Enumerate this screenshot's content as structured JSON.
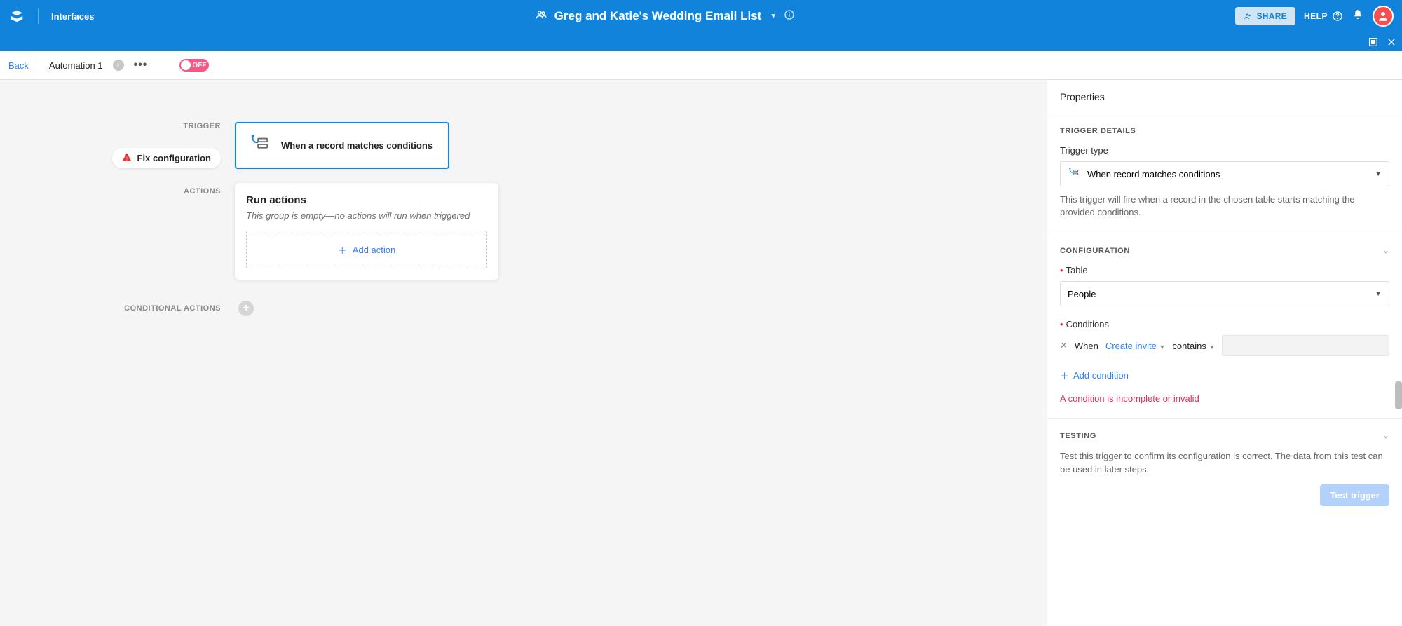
{
  "topbar": {
    "interfaces_label": "Interfaces",
    "base_title": "Greg and Katie's Wedding Email List",
    "share_label": "SHARE",
    "help_label": "HELP"
  },
  "header": {
    "back_label": "Back",
    "automation_name": "Automation 1",
    "dots": "•••",
    "toggle_label": "OFF"
  },
  "canvas": {
    "trigger_section_label": "TRIGGER",
    "fix_label": "Fix configuration",
    "trigger_title": "When a record matches conditions",
    "actions_section_label": "ACTIONS",
    "run_actions_title": "Run actions",
    "empty_text": "This group is empty—no actions will run when triggered",
    "add_action_label": "Add action",
    "conditional_label": "CONDITIONAL ACTIONS"
  },
  "side": {
    "header": "Properties",
    "trigger_details": {
      "title": "TRIGGER DETAILS",
      "type_label": "Trigger type",
      "type_value": "When record matches conditions",
      "hint": "This trigger will fire when a record in the chosen table starts matching the provided conditions."
    },
    "configuration": {
      "title": "CONFIGURATION",
      "table_label": "Table",
      "table_value": "People",
      "conditions_label": "Conditions",
      "when_label": "When",
      "field_value": "Create invite",
      "operator_value": "contains",
      "add_condition_label": "Add condition",
      "error_text": "A condition is incomplete or invalid"
    },
    "testing": {
      "title": "TESTING",
      "hint": "Test this trigger to confirm its configuration is correct. The data from this test can be used in later steps.",
      "button_label": "Test trigger"
    }
  }
}
